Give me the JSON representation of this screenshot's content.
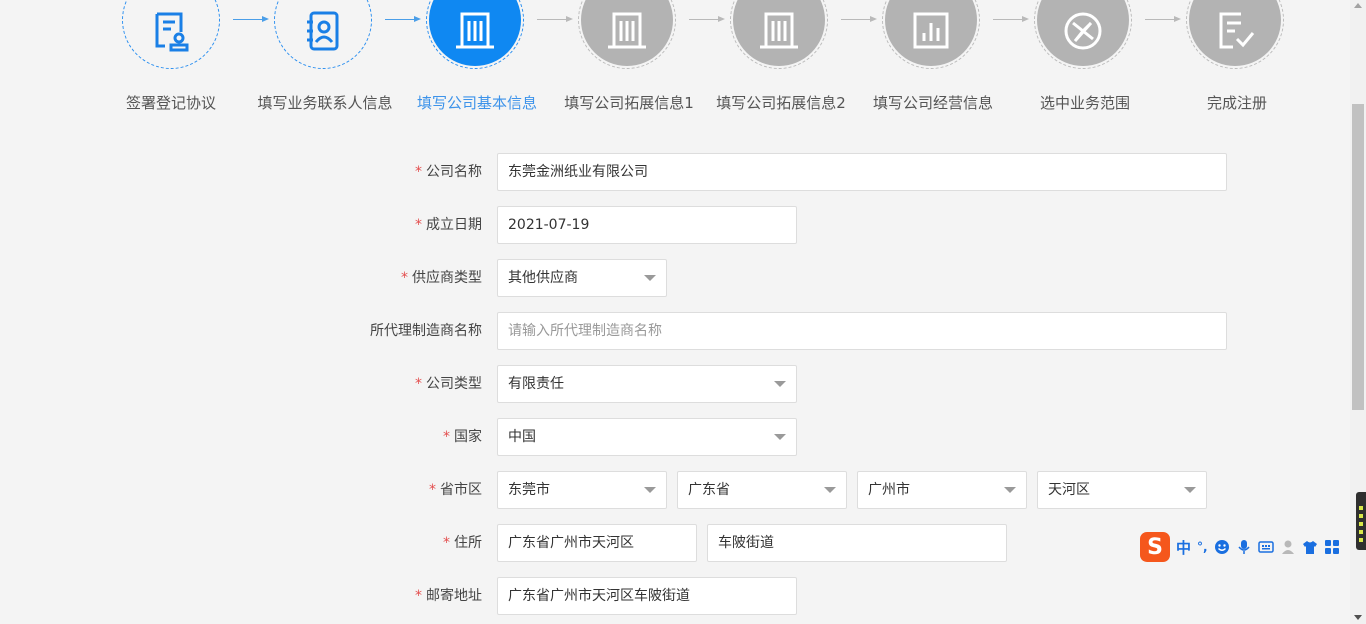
{
  "steps": [
    {
      "label": "签署登记协议",
      "state": "done",
      "icon": "contract-stamp-icon"
    },
    {
      "label": "填写业务联系人信息",
      "state": "done",
      "icon": "contact-book-icon"
    },
    {
      "label": "填写公司基本信息",
      "state": "active",
      "icon": "building-icon"
    },
    {
      "label": "填写公司拓展信息1",
      "state": "todo",
      "icon": "building-icon"
    },
    {
      "label": "填写公司拓展信息2",
      "state": "todo",
      "icon": "building-icon"
    },
    {
      "label": "填写公司经营信息",
      "state": "todo",
      "icon": "bar-chart-icon"
    },
    {
      "label": "选中业务范围",
      "state": "todo",
      "icon": "compass-icon"
    },
    {
      "label": "完成注册",
      "state": "todo",
      "icon": "check-document-icon"
    }
  ],
  "form": {
    "company_name": {
      "label": "公司名称",
      "required": true,
      "value": "东莞金洲纸业有限公司"
    },
    "founded_date": {
      "label": "成立日期",
      "required": true,
      "value": "2021-07-19"
    },
    "supplier_type": {
      "label": "供应商类型",
      "required": true,
      "value": "其他供应商"
    },
    "agent_manufacturer": {
      "label": "所代理制造商名称",
      "required": false,
      "placeholder": "请输入所代理制造商名称"
    },
    "company_type": {
      "label": "公司类型",
      "required": true,
      "value": "有限责任"
    },
    "country": {
      "label": "国家",
      "required": true,
      "value": "中国"
    },
    "region": {
      "label": "省市区",
      "required": true,
      "values": [
        "东莞市",
        "广东省",
        "广州市",
        "天河区"
      ]
    },
    "residence": {
      "label": "住所",
      "required": true,
      "values": [
        "广东省广州市天河区",
        "车陂街道"
      ]
    },
    "mailing_address": {
      "label": "邮寄地址",
      "required": true,
      "value": "广东省广州市天河区车陂街道"
    }
  },
  "required_mark": "*",
  "ime": {
    "logo": "S",
    "mode": "中",
    "punct": "°,"
  },
  "colors": {
    "accent": "#0f88f2",
    "inactive": "#b3b3b3",
    "required": "#e34d4d",
    "ime_logo": "#f5571c"
  }
}
